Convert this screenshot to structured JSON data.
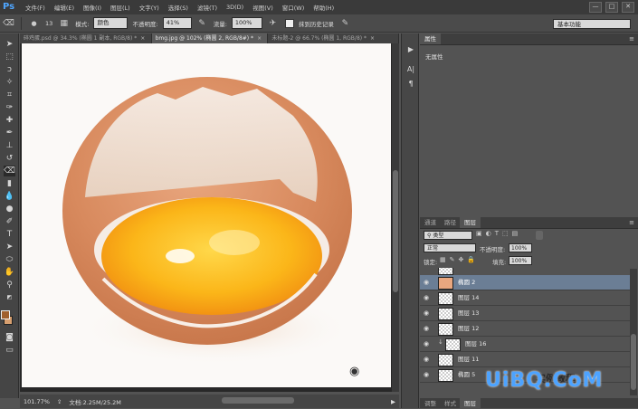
{
  "menubar": {
    "logo": "Ps",
    "items": [
      "文件(F)",
      "编辑(E)",
      "图像(I)",
      "图层(L)",
      "文字(Y)",
      "选择(S)",
      "滤镜(T)",
      "3D(D)",
      "视图(V)",
      "窗口(W)",
      "帮助(H)"
    ],
    "win_min": "—",
    "win_max": "□",
    "win_close": "✕"
  },
  "options": {
    "mode_label": "模式:",
    "mode_value": "颜色",
    "opacity_label": "不透明度:",
    "opacity_value": "41%",
    "flow_label": "流量:",
    "flow_value": "100%",
    "history_label": "抹到历史记录",
    "brush_size": "13",
    "workspace": "基本功能"
  },
  "tabs": [
    {
      "label": "碎鸡蛋.psd @ 34.3% (椭圆 1 副本, RGB/8) *",
      "active": false
    },
    {
      "label": "bmg.jpg @ 102% (椭圆 2, RGB/8#) *",
      "active": true
    },
    {
      "label": "未标题-2 @ 66.7% (椭圆 1, RGB/8) *",
      "active": false
    }
  ],
  "status": {
    "zoom": "101.77%",
    "doc": "文档:2.25M/25.2M"
  },
  "properties": {
    "tabs": [
      "属性"
    ],
    "content": "无属性"
  },
  "layers": {
    "tabs": [
      "通道",
      "路径",
      "图层"
    ],
    "filter_value": "类型",
    "blend_value": "正常",
    "opacity_label": "不透明度:",
    "opacity_value": "100%",
    "lock_label": "锁定:",
    "fill_label": "填充:",
    "fill_value": "100%",
    "rows": [
      {
        "name": "椭圆 2",
        "selected": true
      },
      {
        "name": "图层 14",
        "selected": false
      },
      {
        "name": "图层 13",
        "selected": false
      },
      {
        "name": "图层 12",
        "selected": false
      },
      {
        "name": "图层 16",
        "selected": false
      },
      {
        "name": "图层 11",
        "selected": false
      },
      {
        "name": "椭圆 5",
        "selected": false
      }
    ],
    "bottom_tabs": [
      "调整",
      "样式",
      "图层"
    ]
  },
  "watermark": {
    "text": "UiBQ.CoM",
    "subtext": "实例教程"
  },
  "colors": {
    "selection": "#6b7e95",
    "foreground": "#a0602e",
    "background": "#d8a070"
  }
}
